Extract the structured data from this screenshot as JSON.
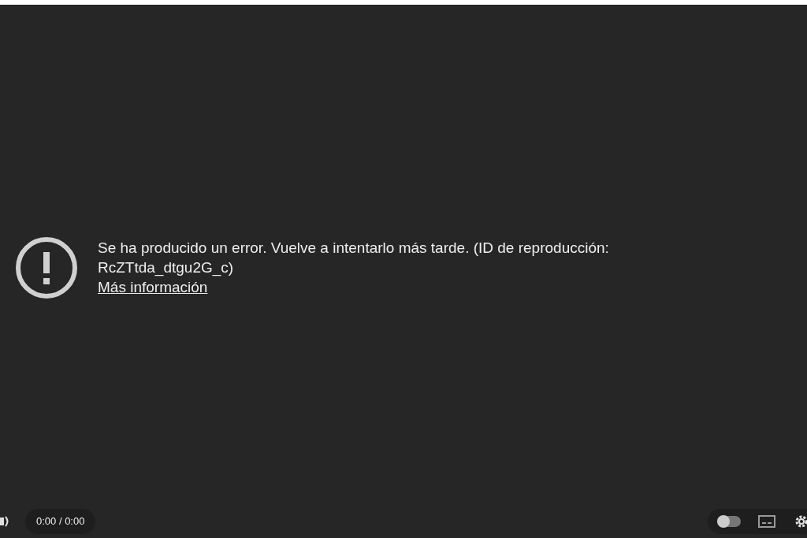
{
  "error": {
    "message": "Se ha producido un error. Vuelve a intentarlo más tarde. (ID de reproducción: RcZTtda_dtgu2G_c)",
    "link": "Más información"
  },
  "controls": {
    "time": "0:00 / 0:00",
    "autoplay": {
      "on": false
    }
  }
}
